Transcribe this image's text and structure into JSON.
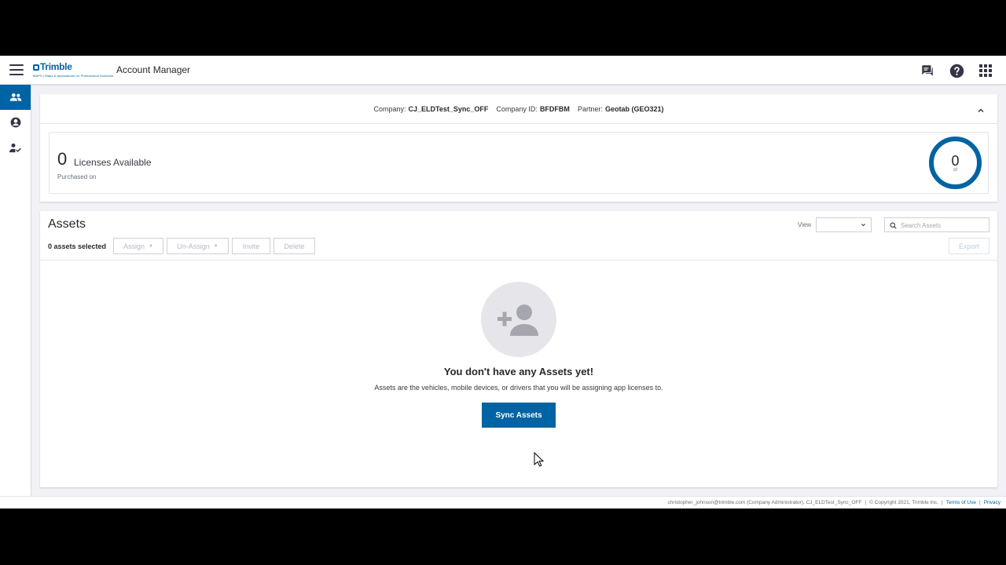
{
  "header": {
    "logo_text": "Trimble",
    "logo_sub": "MAPS | Maps & Applications for Professional Solutions",
    "app_title": "Account Manager",
    "icons": [
      "menu-icon",
      "chat-icon",
      "help-icon",
      "apps-grid-icon"
    ]
  },
  "sidebar": {
    "items": [
      {
        "icon": "users-icon",
        "active": true
      },
      {
        "icon": "account-circle-icon",
        "active": false
      },
      {
        "icon": "user-check-icon",
        "active": false
      }
    ]
  },
  "company": {
    "company_label": "Company:",
    "company_value": "CJ_ELDTest_Sync_OFF",
    "id_label": "Company ID:",
    "id_value": "BFDFBM",
    "partner_label": "Partner:",
    "partner_value": "Geotab (GEO321)"
  },
  "licenses": {
    "count": "0",
    "label": "Licenses Available",
    "purchased": "Purchased on",
    "donut_value": "0",
    "donut_of": "of",
    "donut_fill_fraction": 0
  },
  "assets": {
    "title": "Assets",
    "view_label": "View",
    "view_value": "",
    "search_placeholder": "Search Assets",
    "selected_text": "0 assets selected",
    "buttons": {
      "assign": "Assign",
      "unassign": "Un-Assign",
      "invite": "Invite",
      "delete": "Delete",
      "export": "Export"
    },
    "empty_title": "You don't have any Assets yet!",
    "empty_desc": "Assets are the vehicles, mobile devices, or drivers that you will be assigning app licenses to.",
    "sync_label": "Sync Assets"
  },
  "footer": {
    "user": "christopher_johnson@trimble.com (Company Administrator), CJ_ELDTest_Sync_OFF",
    "copyright": "© Copyright 2021, Trimble Inc.",
    "terms": "Terms of Use",
    "privacy": "Privacy"
  },
  "colors": {
    "brand": "#0063a3",
    "background": "#f1f1f6"
  }
}
